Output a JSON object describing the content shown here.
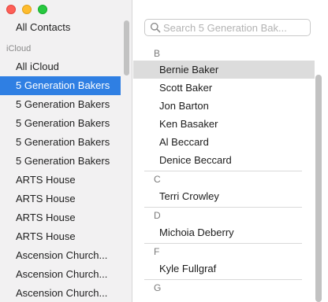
{
  "sidebar": {
    "all_contacts": "All Contacts",
    "group_header": "iCloud",
    "items": [
      "All iCloud",
      "5 Generation Bakers",
      "5 Generation Bakers",
      "5 Generation Bakers",
      "5 Generation Bakers",
      "5 Generation Bakers",
      "ARTS House",
      "ARTS House",
      "ARTS House",
      "ARTS House",
      "Ascension Church...",
      "Ascension Church...",
      "Ascension Church..."
    ],
    "selected_index": 1
  },
  "search": {
    "placeholder": "Search 5 Generation Bak..."
  },
  "contacts": {
    "letters": [
      "B",
      "C",
      "D",
      "F",
      "G"
    ],
    "names": [
      "Bernie Baker",
      "Scott Baker",
      "Jon Barton",
      "Ken Basaker",
      "Al Beccard",
      "Denice Beccard",
      "Terri Crowley",
      "Michoia Deberry",
      "Kyle Fullgraf"
    ],
    "highlighted_index": 0
  },
  "colors": {
    "selection": "#2f7fe3",
    "highlight": "#dcdcdc",
    "sidebar_bg": "#f2f1f2"
  }
}
